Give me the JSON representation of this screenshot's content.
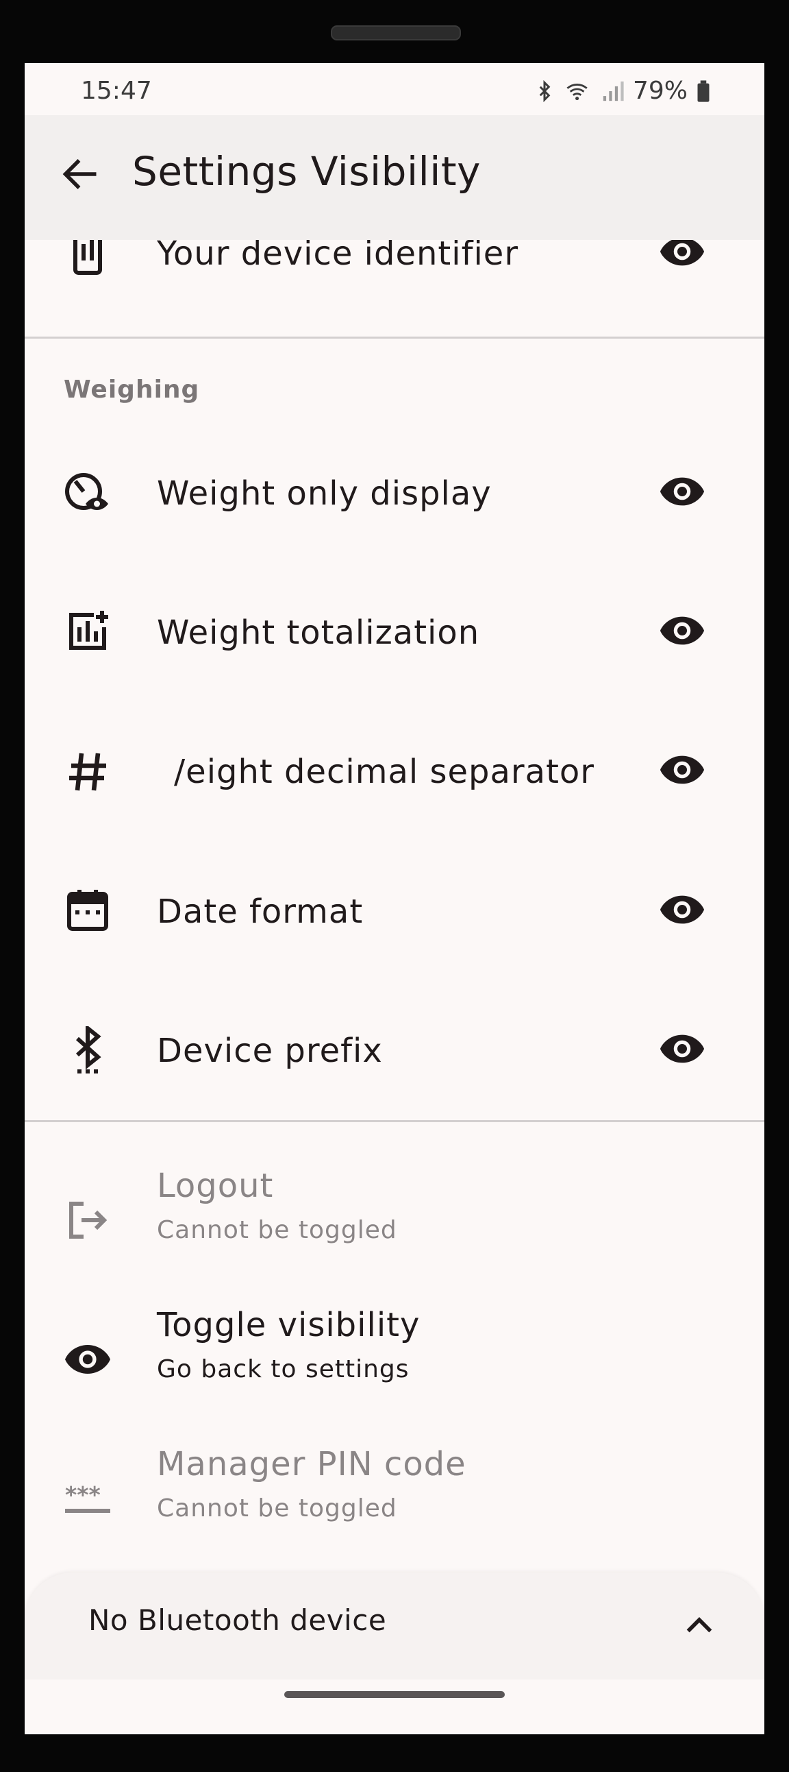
{
  "status_bar": {
    "time": "15:47",
    "battery": "79%",
    "icons": [
      "bluetooth-icon",
      "wifi-icon",
      "signal-icon",
      "battery-icon"
    ]
  },
  "app_bar": {
    "title": "Settings Visibility",
    "back_icon": "arrow-back-icon"
  },
  "top_item": {
    "label": "Your device identifier",
    "icon": "device-id-icon",
    "visibility_icon": "eye-icon"
  },
  "weighing": {
    "section_label": "Weighing",
    "items": [
      {
        "label": "Weight only display",
        "icon": "weight-only-display-icon",
        "visibility_icon": "eye-icon"
      },
      {
        "label": "Weight totalization",
        "icon": "weight-totalization-icon",
        "visibility_icon": "eye-icon"
      },
      {
        "label": "/eight decimal separator",
        "icon": "hash-icon",
        "visibility_icon": "eye-icon"
      },
      {
        "label": "Date format",
        "icon": "calendar-icon",
        "visibility_icon": "eye-icon"
      },
      {
        "label": "Device prefix",
        "icon": "bluetooth-searching-icon",
        "visibility_icon": "eye-icon"
      }
    ]
  },
  "fixed_items": [
    {
      "title": "Logout",
      "subtitle": "Cannot be toggled",
      "icon": "logout-icon",
      "enabled": false
    },
    {
      "title": "Toggle visibility",
      "subtitle": "Go back to settings",
      "icon": "eye-icon",
      "enabled": true
    },
    {
      "title": "Manager PIN code",
      "subtitle": "Cannot be toggled",
      "icon": "password-icon",
      "enabled": false
    }
  ],
  "bottom_sheet": {
    "label": "No Bluetooth device",
    "icon": "chevron-up-icon"
  },
  "colors": {
    "background": "#fcf8f7",
    "app_bar": "#f2efee",
    "text": "#201a1b",
    "disabled_text": "#8a8586"
  }
}
